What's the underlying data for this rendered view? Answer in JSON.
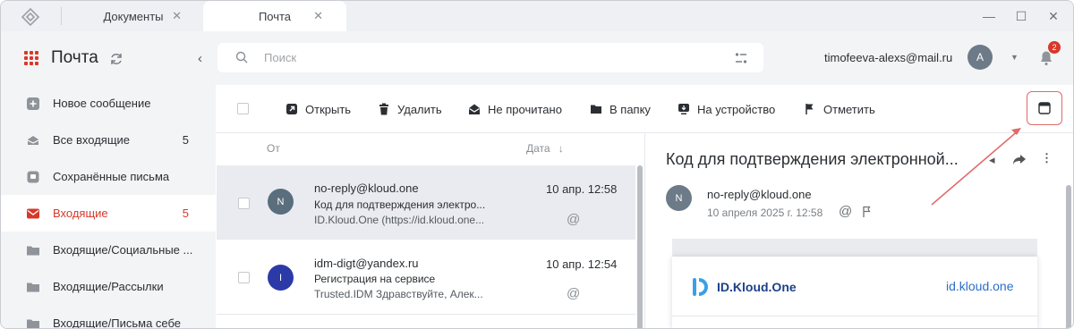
{
  "tabs": [
    {
      "label": "Документы"
    },
    {
      "label": "Почта"
    }
  ],
  "window_controls": {
    "minimize": "—",
    "maximize": "☐",
    "close": "✕"
  },
  "app": {
    "title": "Почта"
  },
  "sidebar": {
    "items": [
      {
        "label": "Новое сообщение",
        "count": ""
      },
      {
        "label": "Все входящие",
        "count": "5"
      },
      {
        "label": "Сохранённые письма",
        "count": ""
      },
      {
        "label": "Входящие",
        "count": "5"
      },
      {
        "label": "Входящие/Социальные ...",
        "count": ""
      },
      {
        "label": "Входящие/Рассылки",
        "count": ""
      },
      {
        "label": "Входящие/Письма себе",
        "count": ""
      }
    ]
  },
  "search": {
    "placeholder": "Поиск"
  },
  "account": {
    "email": "timofeeva-alexs@mail.ru",
    "avatar_letter": "A",
    "notifications": "2"
  },
  "toolbar": {
    "open": "Открыть",
    "delete": "Удалить",
    "unread": "Не прочитано",
    "to_folder": "В папку",
    "to_device": "На устройство",
    "flag": "Отметить"
  },
  "list": {
    "col_from": "От",
    "col_date": "Дата",
    "sort_arrow": "↓",
    "rows": [
      {
        "avatar": "N",
        "from": "no-reply@kloud.one",
        "subject": "Код для подтверждения электро...",
        "preview": "ID.Kloud.One (https://id.kloud.one...",
        "date": "10 апр. 12:58",
        "at": "@",
        "avatar_color": "#5b6e7d"
      },
      {
        "avatar": "I",
        "from": "idm-digt@yandex.ru",
        "subject": "Регистрация на сервисе",
        "preview": "Trusted.IDM Здравствуйте, Алек...",
        "date": "10 апр. 12:54",
        "at": "@",
        "avatar_color": "#2c3aa8"
      }
    ]
  },
  "reader": {
    "title": "Код для подтверждения электронной...",
    "avatar": "N",
    "from": "no-reply@kloud.one",
    "date": "10 апреля 2025 г. 12:58",
    "brand_name": "ID.Kloud.One",
    "brand_link": "id.kloud.one"
  },
  "colors": {
    "accent": "#d8382a",
    "highlight_box": "#e06a6a",
    "brand": "#1c3f8a",
    "link": "#2b6fc4"
  }
}
